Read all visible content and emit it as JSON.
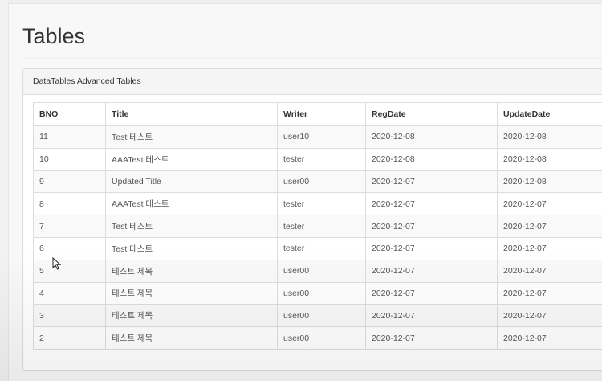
{
  "page": {
    "title": "Tables"
  },
  "panel": {
    "heading": "DataTables Advanced Tables"
  },
  "table": {
    "columns": [
      "BNO",
      "Title",
      "Writer",
      "RegDate",
      "UpdateDate"
    ],
    "rows": [
      [
        "11",
        "Test 테스트",
        "user10",
        "2020-12-08",
        "2020-12-08"
      ],
      [
        "10",
        "AAATest 테스트",
        "tester",
        "2020-12-08",
        "2020-12-08"
      ],
      [
        "9",
        "Updated Title",
        "user00",
        "2020-12-07",
        "2020-12-08"
      ],
      [
        "8",
        "AAATest 테스트",
        "tester",
        "2020-12-07",
        "2020-12-07"
      ],
      [
        "7",
        "Test 테스트",
        "tester",
        "2020-12-07",
        "2020-12-07"
      ],
      [
        "6",
        "Test 테스트",
        "tester",
        "2020-12-07",
        "2020-12-07"
      ],
      [
        "5",
        "테스트 제목",
        "user00",
        "2020-12-07",
        "2020-12-07"
      ],
      [
        "4",
        "테스트 제목",
        "user00",
        "2020-12-07",
        "2020-12-07"
      ],
      [
        "3",
        "테스트 제목",
        "user00",
        "2020-12-07",
        "2020-12-07"
      ],
      [
        "2",
        "테스트 제목",
        "user00",
        "2020-12-07",
        "2020-12-07"
      ]
    ]
  },
  "cursor": {
    "icon": "mouse-pointer-icon"
  }
}
